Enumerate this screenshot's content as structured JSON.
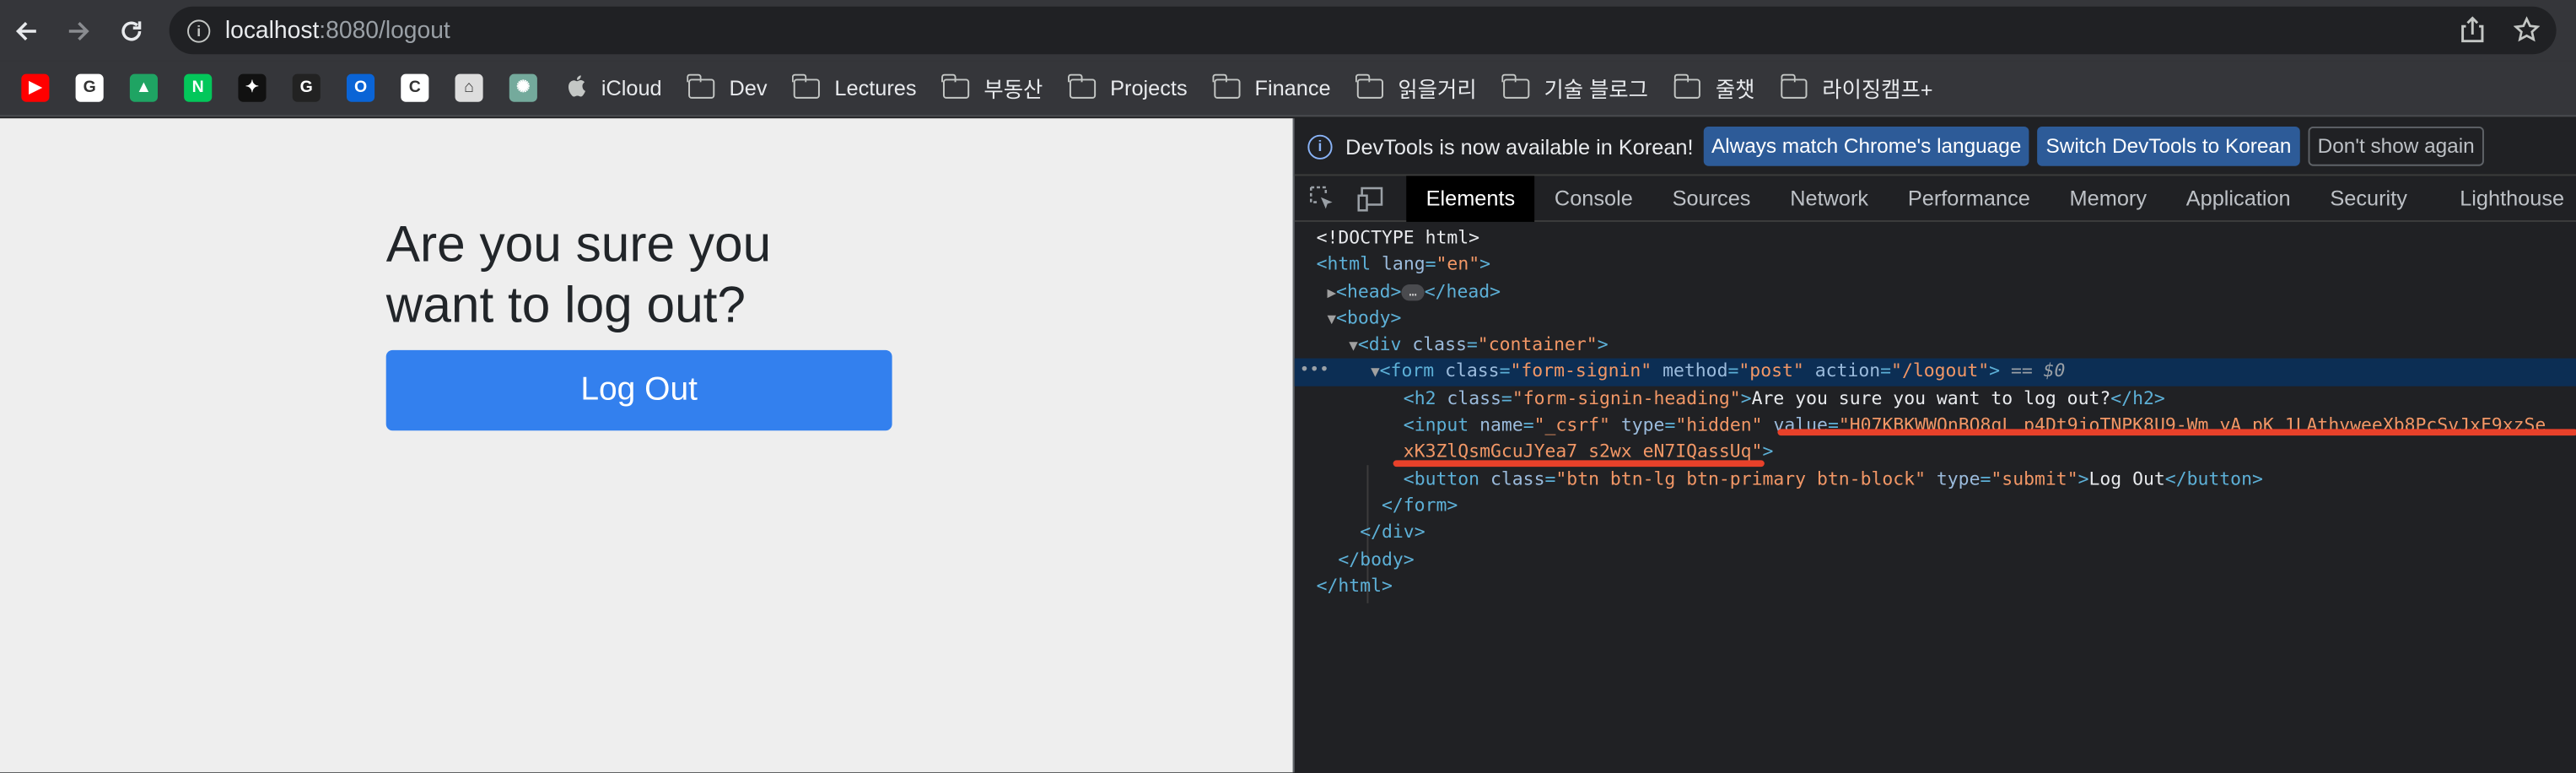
{
  "browser": {
    "url_host": "localhost",
    "url_rest": ":8080/logout",
    "bookmarks": [
      {
        "type": "fav",
        "icon": "youtube-icon",
        "color": "#ff0000",
        "glyph": "▶"
      },
      {
        "type": "fav",
        "icon": "google-icon",
        "color": "#ffffff",
        "glyph": "G"
      },
      {
        "type": "fav",
        "icon": "google-drive-icon",
        "color": "#1fa463",
        "glyph": "▲"
      },
      {
        "type": "fav",
        "icon": "naver-icon",
        "color": "#03c75a",
        "glyph": "N"
      },
      {
        "type": "fav",
        "icon": "app-icon",
        "color": "#111111",
        "glyph": "✦"
      },
      {
        "type": "fav",
        "icon": "g-app-icon",
        "color": "#222222",
        "glyph": "G"
      },
      {
        "type": "fav",
        "icon": "outlook-icon",
        "color": "#0a64d6",
        "glyph": "O"
      },
      {
        "type": "fav",
        "icon": "c-app-icon",
        "color": "#ffffff",
        "glyph": "C"
      },
      {
        "type": "fav",
        "icon": "person-app-icon",
        "color": "#dddddd",
        "glyph": "⌂"
      },
      {
        "type": "fav",
        "icon": "chatgpt-icon",
        "color": "#74aa9c",
        "glyph": "✺"
      },
      {
        "type": "apple",
        "label": "iCloud"
      },
      {
        "type": "folder",
        "label": "Dev"
      },
      {
        "type": "folder",
        "label": "Lectures"
      },
      {
        "type": "folder",
        "label": "부동산"
      },
      {
        "type": "folder",
        "label": "Projects"
      },
      {
        "type": "folder",
        "label": "Finance"
      },
      {
        "type": "folder",
        "label": "읽을거리"
      },
      {
        "type": "folder",
        "label": "기술 블로그"
      },
      {
        "type": "folder",
        "label": "줄챗"
      },
      {
        "type": "folder",
        "label": "라이징캠프+"
      }
    ]
  },
  "page": {
    "heading": "Are you sure you want to log out?",
    "button_label": "Log Out"
  },
  "devtools": {
    "info_message": "DevTools is now available in Korean!",
    "btn_match": "Always match Chrome's language",
    "btn_switch": "Switch DevTools to Korean",
    "btn_dismiss": "Don't show again",
    "tabs": [
      "Elements",
      "Console",
      "Sources",
      "Network",
      "Performance",
      "Memory",
      "Application",
      "Security",
      "Lighthouse"
    ],
    "active_tab": "Elements",
    "csrf_value_1": "H07KBKWWQnBQ8gL_p4Dt9joTNPK8U9-Wm_yA_pK_1LAthvweeXb8PcSvJxF9xzSe",
    "csrf_value_2": "xK3ZlQsmGcuJYea7_s2wx_eN7IQassUq",
    "dollar0": "== $0"
  }
}
